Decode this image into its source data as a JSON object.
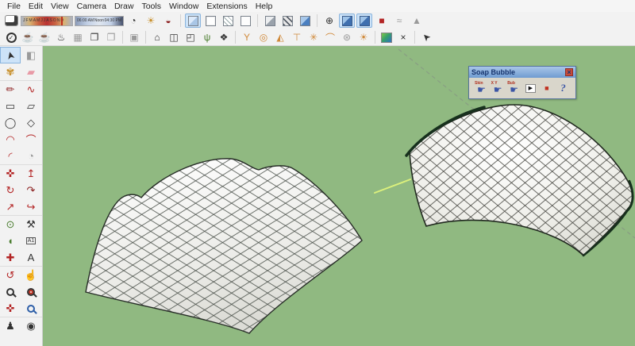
{
  "menu": {
    "items": [
      "File",
      "Edit",
      "View",
      "Camera",
      "Draw",
      "Tools",
      "Window",
      "Extensions",
      "Help"
    ]
  },
  "toolbar_top": {
    "months": "JFMAMJJASOND",
    "time_left": "06:00 AM",
    "time_noon": "Noon",
    "time_right": "04:30 PM",
    "icons": [
      {
        "name": "shadow-time-icon",
        "glyph": "◔"
      },
      {
        "name": "shadow-date-icon",
        "glyph": "☀"
      },
      {
        "name": "shadow-toggle-icon",
        "glyph": "◒"
      },
      {
        "name": "axes-icon",
        "glyph": "⊕"
      },
      {
        "name": "red-material-icon",
        "glyph": "■"
      },
      {
        "name": "sandbox-icon",
        "glyph": "≈"
      },
      {
        "name": "terrain-icon",
        "glyph": "▲"
      }
    ]
  },
  "toolbar_second": {
    "icons": [
      {
        "name": "render-check-icon",
        "glyph": "✓"
      },
      {
        "name": "teapot-icon",
        "glyph": "☕"
      },
      {
        "name": "teapot-grab-icon",
        "glyph": "☕"
      },
      {
        "name": "render-scene-icon",
        "glyph": "♨"
      },
      {
        "name": "render-options-icon",
        "glyph": "▦"
      },
      {
        "name": "render-window-icon",
        "glyph": "❐"
      },
      {
        "name": "material-window-icon",
        "glyph": "❐"
      },
      {
        "name": "lock-icon",
        "glyph": "▣"
      },
      {
        "name": "bridge-icon",
        "glyph": "⌂"
      },
      {
        "name": "box-icon",
        "glyph": "◫"
      },
      {
        "name": "box-axes-icon",
        "glyph": "◰"
      },
      {
        "name": "grass-icon",
        "glyph": "ψ"
      },
      {
        "name": "leaf-icon",
        "glyph": "❖"
      },
      {
        "name": "glass-icon",
        "glyph": "Y"
      },
      {
        "name": "donut-icon",
        "glyph": "◎"
      },
      {
        "name": "sail-icon",
        "glyph": "◭"
      },
      {
        "name": "table-icon",
        "glyph": "⊤"
      },
      {
        "name": "star-icon",
        "glyph": "✳"
      },
      {
        "name": "dome-icon",
        "glyph": "⌒"
      },
      {
        "name": "wheel-icon",
        "glyph": "⊛"
      },
      {
        "name": "sun-icon",
        "glyph": "☀"
      },
      {
        "name": "snap-icon",
        "glyph": "×"
      },
      {
        "name": "cursor-icon",
        "glyph": "➤"
      }
    ]
  },
  "sidebar": {
    "tools": [
      {
        "name": "select-tool",
        "glyph": "➤"
      },
      {
        "name": "component-tool",
        "glyph": "◧"
      },
      {
        "name": "paint-tool",
        "glyph": "✾"
      },
      {
        "name": "eraser-tool",
        "glyph": "▰"
      },
      {
        "name": "line-tool",
        "glyph": "✏"
      },
      {
        "name": "freehand-tool",
        "glyph": "∿"
      },
      {
        "name": "rectangle-tool",
        "glyph": "▭"
      },
      {
        "name": "rotated-rectangle-tool",
        "glyph": "▱"
      },
      {
        "name": "circle-tool",
        "glyph": "◯"
      },
      {
        "name": "polygon-tool",
        "glyph": "◇"
      },
      {
        "name": "arc-tool",
        "glyph": "◠"
      },
      {
        "name": "two-point-arc-tool",
        "glyph": "⌒"
      },
      {
        "name": "three-point-arc-tool",
        "glyph": "◜"
      },
      {
        "name": "pie-tool",
        "glyph": "◔"
      },
      {
        "name": "move-tool",
        "glyph": "✜"
      },
      {
        "name": "pushpull-tool",
        "glyph": "↥"
      },
      {
        "name": "rotate-tool",
        "glyph": "↻"
      },
      {
        "name": "followme-tool",
        "glyph": "↷"
      },
      {
        "name": "scale-tool",
        "glyph": "↗"
      },
      {
        "name": "offset-tool",
        "glyph": "↪"
      },
      {
        "name": "tape-measure-tool",
        "glyph": "⊙"
      },
      {
        "name": "dimension-tool",
        "glyph": "⚒"
      },
      {
        "name": "protractor-tool",
        "glyph": "◖"
      },
      {
        "name": "text-tool",
        "glyph": "A1"
      },
      {
        "name": "axes-tool",
        "glyph": "✚"
      },
      {
        "name": "3d-text-tool",
        "glyph": "A"
      },
      {
        "name": "orbit-tool",
        "glyph": "↺"
      },
      {
        "name": "pan-tool",
        "glyph": "☝"
      },
      {
        "name": "zoom-tool",
        "glyph": ""
      },
      {
        "name": "zoom-window-tool",
        "glyph": ""
      },
      {
        "name": "zoom-extents-tool",
        "glyph": "✜"
      },
      {
        "name": "zoom-previous-tool",
        "glyph": ""
      },
      {
        "name": "position-camera-tool",
        "glyph": "♟"
      },
      {
        "name": "look-around-tool",
        "glyph": "◉"
      }
    ]
  },
  "dialog": {
    "title": "Soap Bubble",
    "close": "×",
    "buttons": [
      {
        "name": "skin-button",
        "label": "Skin",
        "glyph": "☛"
      },
      {
        "name": "xy-button",
        "label": "X Y",
        "glyph": "☛"
      },
      {
        "name": "bubble-button",
        "label": "Bub",
        "glyph": "☛"
      },
      {
        "name": "play-button",
        "glyph": "▶"
      },
      {
        "name": "stop-button",
        "glyph": "■"
      },
      {
        "name": "help-button",
        "glyph": "?"
      }
    ]
  },
  "viewport": {
    "background": "#90b981",
    "guide_color": "#879a83",
    "axis_color": "#dbf07c",
    "mesh_fill": "#f6f6f3",
    "mesh_line": "#3f463f"
  }
}
